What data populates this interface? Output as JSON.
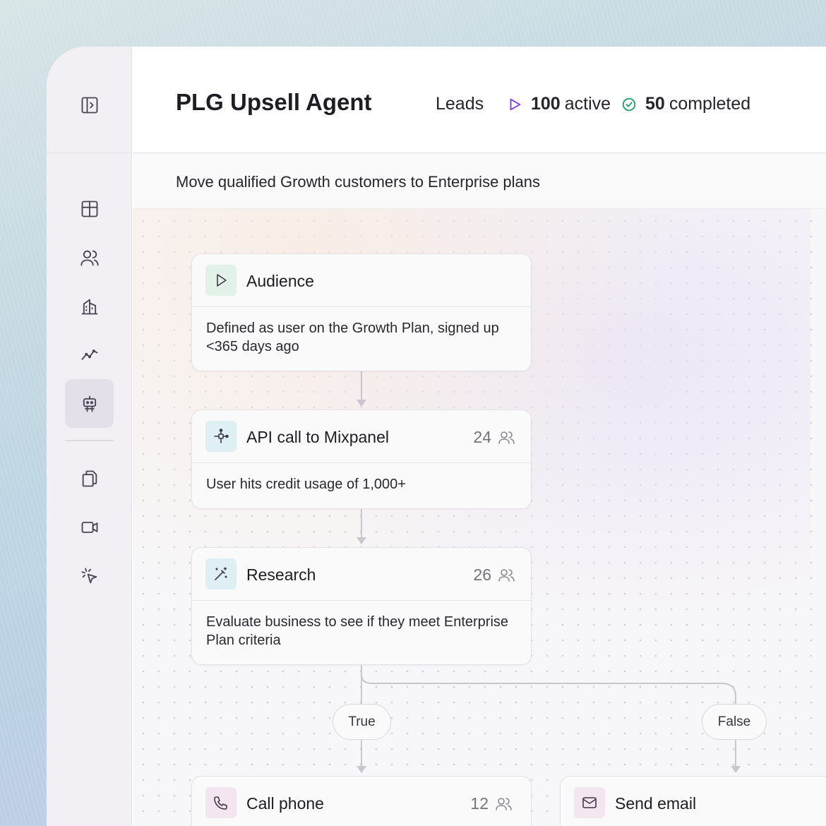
{
  "app": {
    "title": "PLG Upsell Agent",
    "subtitle": "Move qualified Growth customers to Enterprise plans"
  },
  "stats": {
    "leads_label": "Leads",
    "active_count": "100",
    "active_label": "active",
    "completed_count": "50",
    "completed_label": "completed",
    "active_color": "#7c3aed",
    "completed_color": "#22a06b"
  },
  "sidebar": {
    "items": [
      {
        "icon": "panel-toggle-icon"
      },
      {
        "icon": "dashboard-icon"
      },
      {
        "icon": "users-icon"
      },
      {
        "icon": "building-icon"
      },
      {
        "icon": "analytics-icon"
      },
      {
        "icon": "agent-icon",
        "active": true
      },
      {
        "icon": "documents-icon"
      },
      {
        "icon": "video-icon"
      },
      {
        "icon": "cursor-click-icon"
      }
    ]
  },
  "flow": {
    "nodes": [
      {
        "title": "Audience",
        "count": "",
        "description": "Defined as user on the Growth Plan, signed up <365 days ago",
        "icon": "play-icon",
        "icon_bg": "#e3f2e8"
      },
      {
        "title": "API call to Mixpanel",
        "count": "24",
        "description": "User hits credit usage of 1,000+",
        "icon": "api-icon",
        "icon_bg": "#dff0f5"
      },
      {
        "title": "Research",
        "count": "26",
        "description": "Evaluate business to see if they meet Enterprise Plan criteria",
        "icon": "magic-wand-icon",
        "icon_bg": "#dff0f5"
      },
      {
        "title": "Call phone",
        "count": "12",
        "description": "",
        "icon": "phone-icon",
        "icon_bg": "#f3e6f1"
      },
      {
        "title": "Send email",
        "count": "",
        "description": "",
        "icon": "mail-icon",
        "icon_bg": "#f3e6f1"
      }
    ],
    "branches": {
      "true_label": "True",
      "false_label": "False"
    }
  }
}
